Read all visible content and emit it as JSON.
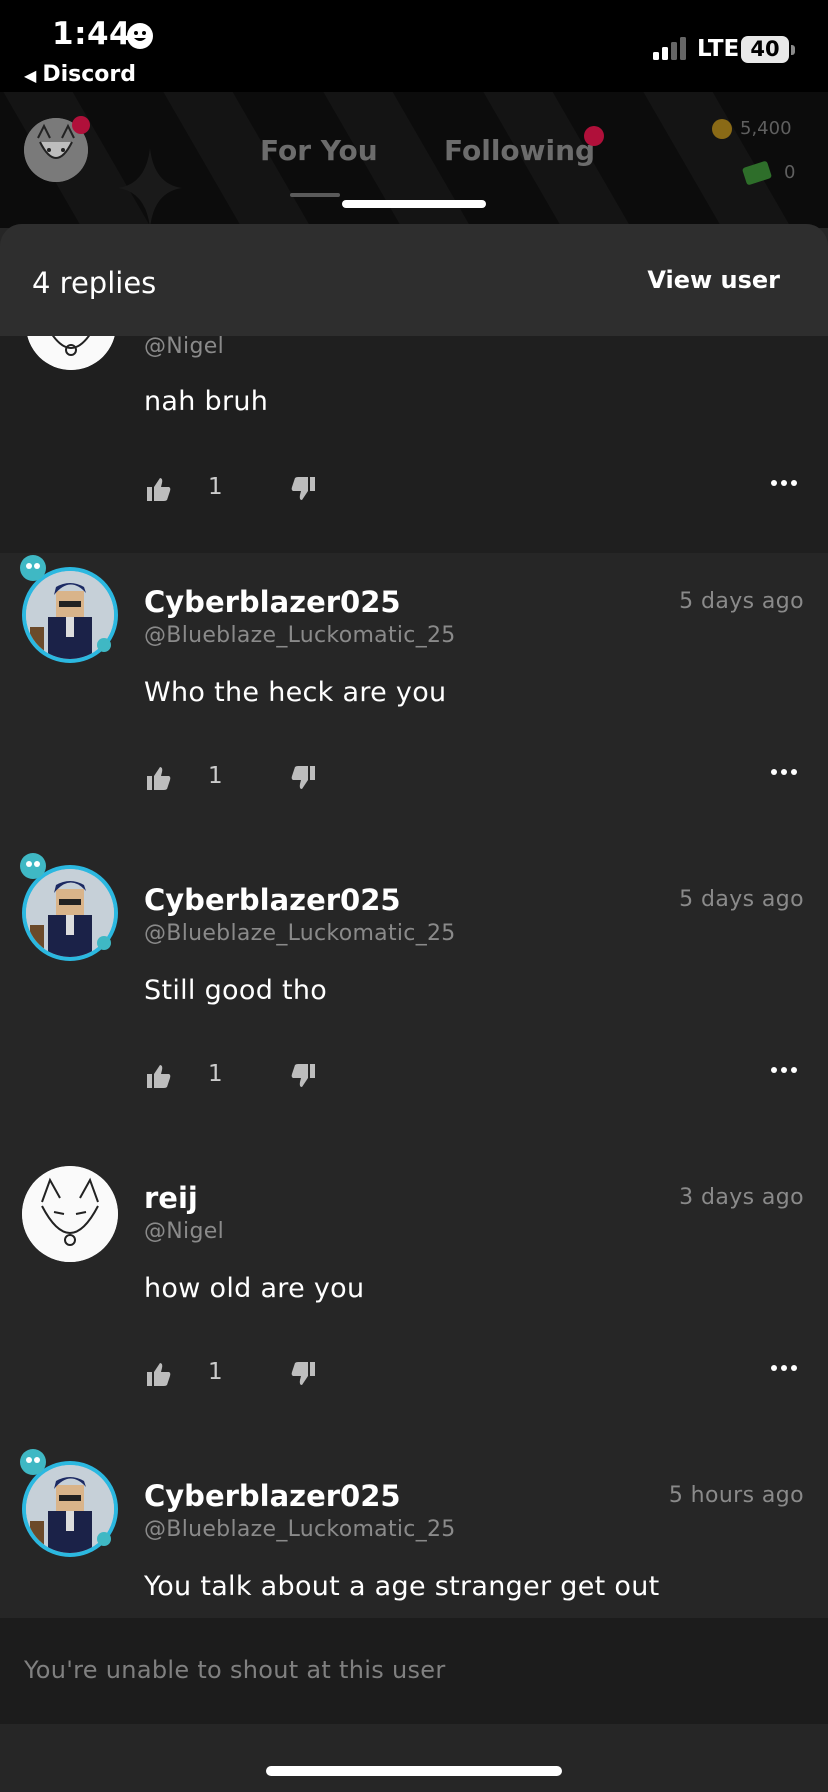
{
  "status_bar": {
    "time": "1:44",
    "back_app": "Discord",
    "network": "LTE",
    "battery": "40"
  },
  "header": {
    "tabs": [
      "For You",
      "Following"
    ],
    "coins": "5,400",
    "cash": "0"
  },
  "sheet": {
    "title": "4 replies",
    "view_user_label": "View user"
  },
  "first_comment": {
    "handle": "@Nigel",
    "text": "nah bruh",
    "likes": "1"
  },
  "comments": [
    {
      "name": "Cyberblazer025",
      "handle": "@Blueblaze_Luckomatic_25",
      "time": "5 days ago",
      "text": "Who the heck are you",
      "likes": "1",
      "avatar": "roblox-avatar"
    },
    {
      "name": "Cyberblazer025",
      "handle": "@Blueblaze_Luckomatic_25",
      "time": "5 days ago",
      "text": "Still good tho",
      "likes": "1",
      "avatar": "roblox-avatar"
    },
    {
      "name": "reij",
      "handle": "@Nigel",
      "time": "3 days ago",
      "text": "how old are you",
      "likes": "1",
      "avatar": "sketch-cat-avatar"
    },
    {
      "name": "Cyberblazer025",
      "handle": "@Blueblaze_Luckomatic_25",
      "time": "5 hours ago",
      "text": "You talk about a age stranger get out",
      "likes": "",
      "avatar": "roblox-avatar"
    }
  ],
  "footer": {
    "note": "You're unable to shout at this user"
  },
  "colors": {
    "accent_ring": "#2bb8e0",
    "notification_dot": "#b0103a",
    "background": "#262626"
  }
}
